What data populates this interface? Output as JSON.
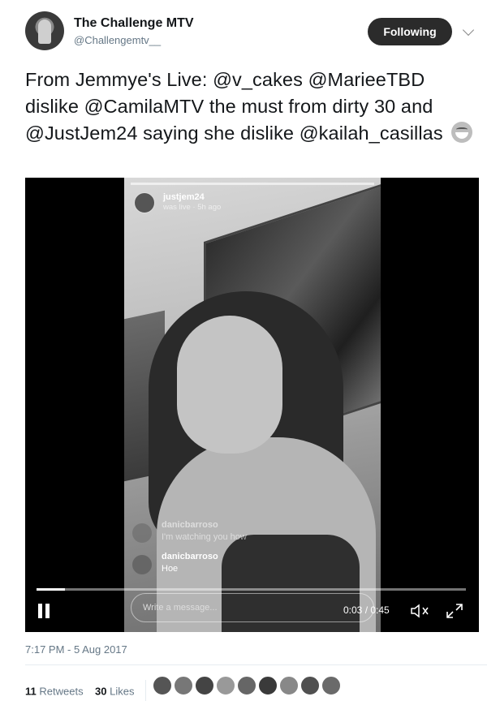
{
  "tweet": {
    "author_name": "The Challenge MTV",
    "author_handle": "@Challengemtv__",
    "follow_label": "Following",
    "text": "From Jemmye's Live: @v_cakes @MarieeTBD dislike @CamilaMTV the must from dirty 30 and @JustJem24 saying she dislike @kailah_casillas",
    "timestamp": "7:17 PM - 5 Aug 2017",
    "retweets_count": "11",
    "retweets_label": "Retweets",
    "likes_count": "30",
    "likes_label": "Likes",
    "liker_avatar_count": 9
  },
  "video": {
    "ig_username": "justjem24",
    "ig_status": "was live · 5h ago",
    "comments": [
      {
        "user": "danicbarroso",
        "text": "I'm watching you how"
      },
      {
        "user": "danicbarroso",
        "text": "Hoe"
      }
    ],
    "message_placeholder": "Write a message...",
    "time_current": "0:03",
    "time_total": "0:45",
    "progress": 0.067
  },
  "icons": {
    "caret": "chevron-down-icon",
    "emoji": "tears-of-joy-emoji-icon",
    "pause": "pause-icon",
    "mute": "volume-muted-icon",
    "expand": "fullscreen-icon"
  },
  "colors": {
    "follow_button_bg": "#2b2b2b",
    "meta_text": "#657786",
    "divider": "#e6ecf0"
  }
}
